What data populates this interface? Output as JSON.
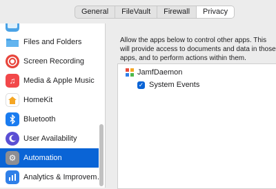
{
  "tabs": [
    {
      "label": "General"
    },
    {
      "label": "FileVault"
    },
    {
      "label": "Firewall"
    },
    {
      "label": "Privacy",
      "active": true
    }
  ],
  "sidebar": {
    "items": [
      {
        "label": "",
        "icon": "partial-folder-icon",
        "color": "#4aa3e6"
      },
      {
        "label": "Files and Folders",
        "icon": "folder-icon",
        "color": "#4aa3e6"
      },
      {
        "label": "Screen Recording",
        "icon": "record-icon",
        "color": "#e8453c"
      },
      {
        "label": "Media & Apple Music",
        "icon": "music-note-icon",
        "color": "#f2484a"
      },
      {
        "label": "HomeKit",
        "icon": "home-icon",
        "color": "#f5a623"
      },
      {
        "label": "Bluetooth",
        "icon": "bluetooth-icon",
        "color": "#1a7cf0"
      },
      {
        "label": "User Availability",
        "icon": "moon-icon",
        "color": "#5b4fd4"
      },
      {
        "label": "Automation",
        "icon": "gear-icon",
        "color": "#8e8e93",
        "selected": true
      },
      {
        "label": "Analytics & Improvem…",
        "icon": "chart-icon",
        "color": "#2f7fe8"
      }
    ]
  },
  "main": {
    "description": "Allow the apps below to control other apps. This will provide access to documents and data in those apps, and to perform actions within them.",
    "apps": [
      {
        "name": "JamfDaemon",
        "icon": "jamf-icon",
        "targets": [
          {
            "name": "System Events",
            "checked": true
          }
        ]
      }
    ]
  },
  "colors": {
    "accent": "#0a64d6"
  }
}
